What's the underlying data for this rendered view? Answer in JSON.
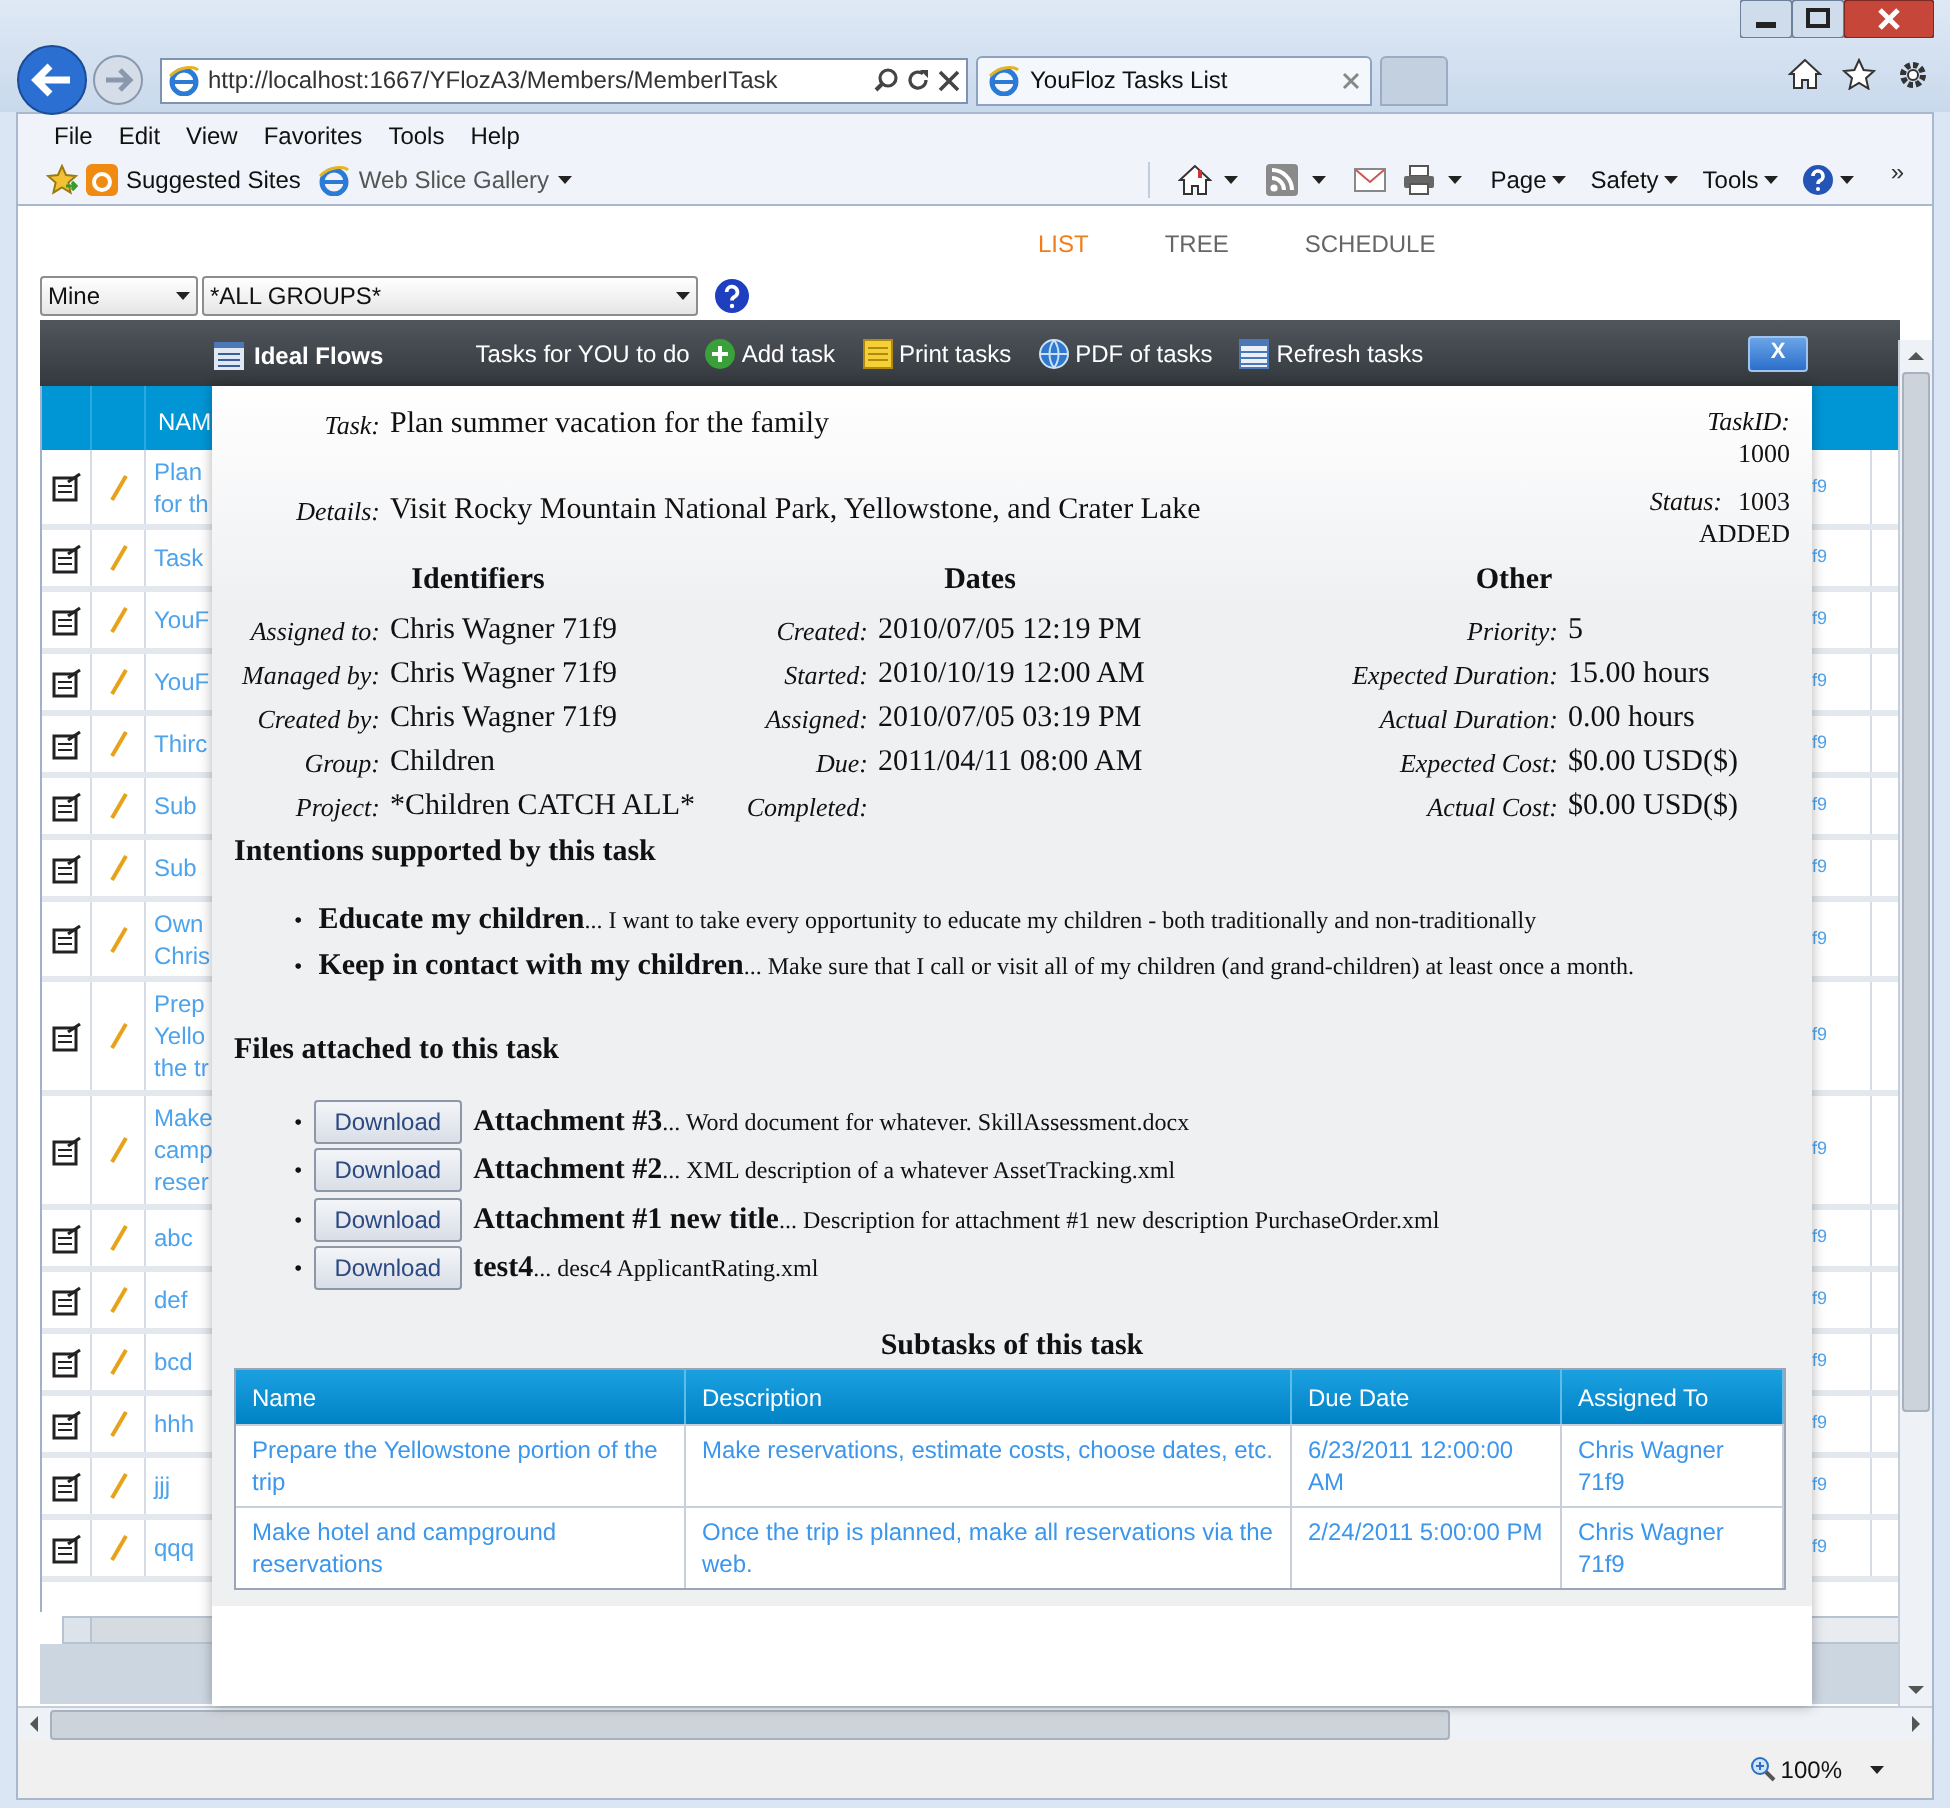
{
  "browser": {
    "url": "http://localhost:1667/YFlozA3/Members/MemberITask",
    "tab_title": "YouFloz Tasks List",
    "menu": [
      "File",
      "Edit",
      "View",
      "Favorites",
      "Tools",
      "Help"
    ],
    "favorites": [
      {
        "kind": "suggested",
        "label": "Suggested Sites"
      },
      {
        "kind": "slice",
        "label": "Web Slice Gallery"
      }
    ],
    "commands": [
      "Page",
      "Safety",
      "Tools"
    ],
    "overflow": "»",
    "zoom": "100%"
  },
  "nav": [
    {
      "label": "LIST",
      "selected": true
    },
    {
      "label": "TREE",
      "selected": false
    },
    {
      "label": "SCHEDULE",
      "selected": false
    }
  ],
  "filters": {
    "owner": "Mine",
    "group": "*ALL GROUPS*"
  },
  "toolbar": {
    "brand": "Ideal Flows",
    "caption": "Tasks for YOU to do",
    "actions": [
      {
        "kind": "add",
        "label": "Add task"
      },
      {
        "kind": "print",
        "label": "Print tasks"
      },
      {
        "kind": "pdf",
        "label": "PDF of tasks"
      },
      {
        "kind": "refresh",
        "label": "Refresh tasks"
      }
    ],
    "close": "X"
  },
  "list": {
    "header": "NAM",
    "rows": [
      {
        "lines": [
          "Plan",
          "for th"
        ],
        "end": "f9"
      },
      {
        "lines": [
          "Task"
        ],
        "end": "f9"
      },
      {
        "lines": [
          "YouF"
        ],
        "end": "f9"
      },
      {
        "lines": [
          "YouF"
        ],
        "end": "f9"
      },
      {
        "lines": [
          "Thirc"
        ],
        "end": "f9"
      },
      {
        "lines": [
          "Sub"
        ],
        "end": "f9"
      },
      {
        "lines": [
          "Sub"
        ],
        "end": "f9"
      },
      {
        "lines": [
          "Own",
          "Chris"
        ],
        "end": "f9"
      },
      {
        "lines": [
          "Prep",
          "Yello",
          "the tr"
        ],
        "end": "f9"
      },
      {
        "lines": [
          "Make",
          "camp",
          "reser"
        ],
        "end": "f9"
      },
      {
        "lines": [
          "abc"
        ],
        "end": "f9"
      },
      {
        "lines": [
          "def"
        ],
        "end": "f9"
      },
      {
        "lines": [
          "bcd"
        ],
        "end": "f9"
      },
      {
        "lines": [
          "hhh"
        ],
        "end": "f9"
      },
      {
        "lines": [
          "jjj"
        ],
        "end": "f9"
      },
      {
        "lines": [
          "qqq"
        ],
        "end": "f9"
      }
    ]
  },
  "detail": {
    "task_label": "Task:",
    "task": "Plan summer vacation for the family",
    "details_label": "Details:",
    "details": "Visit Rocky Mountain National Park, Yellowstone, and Crater Lake",
    "taskid_label": "TaskID:",
    "taskid": "1000",
    "status_label": "Status:",
    "status_code": "1003",
    "status": "ADDED",
    "groups": [
      {
        "title": "Identifiers",
        "fields": [
          {
            "label": "Assigned to:",
            "value": "Chris Wagner 71f9"
          },
          {
            "label": "Managed by:",
            "value": "Chris Wagner 71f9"
          },
          {
            "label": "Created by:",
            "value": "Chris Wagner 71f9"
          },
          {
            "label": "Group:",
            "value": "Children"
          },
          {
            "label": "Project:",
            "value": "*Children CATCH ALL*"
          }
        ]
      },
      {
        "title": "Dates",
        "fields": [
          {
            "label": "Created:",
            "value": "2010/07/05 12:19 PM"
          },
          {
            "label": "Started:",
            "value": "2010/10/19 12:00 AM"
          },
          {
            "label": "Assigned:",
            "value": "2010/07/05 03:19 PM"
          },
          {
            "label": "Due:",
            "value": "2011/04/11 08:00 AM"
          },
          {
            "label": "Completed:"
          }
        ]
      },
      {
        "title": "Other",
        "fields": [
          {
            "label": "Priority:",
            "value": "5"
          },
          {
            "label": "Expected Duration:",
            "value": "15.00 hours"
          },
          {
            "label": "Actual Duration:",
            "value": "0.00 hours"
          },
          {
            "label": "Expected Cost:",
            "value": "$0.00 USD($)"
          },
          {
            "label": "Actual Cost:",
            "value": "$0.00 USD($)"
          }
        ]
      }
    ],
    "intentions_title": "Intentions supported by this task",
    "intentions": [
      {
        "bullet": "•",
        "title": "Educate my children",
        "description": "... I want to take every opportunity to educate my children - both traditionally and non-traditionally"
      },
      {
        "bullet": "•",
        "title": "Keep in contact with my children",
        "description": "... Make sure that I call or visit all of my children (and grand-children) at least once a month."
      }
    ],
    "files_title": "Files attached to this task",
    "files": [
      {
        "bullet": "•",
        "button": "Download",
        "title": "Attachment #3",
        "description": "... Word document for whatever. SkillAssessment.docx"
      },
      {
        "bullet": "•",
        "button": "Download",
        "title": "Attachment #2",
        "description": "... XML description of a whatever AssetTracking.xml"
      },
      {
        "bullet": "•",
        "button": "Download",
        "title": "Attachment #1 new title",
        "description": "... Description for attachment #1 new description PurchaseOrder.xml"
      },
      {
        "bullet": "•",
        "button": "Download",
        "title": "test4",
        "description": "... desc4 ApplicantRating.xml"
      }
    ],
    "subtasks_title": "Subtasks of this task",
    "subtasks": {
      "columns": [
        "Name",
        "Description",
        "Due Date",
        "Assigned To"
      ],
      "rows": [
        [
          "Prepare the Yellowstone portion of the trip",
          "Make reservations, estimate costs, choose dates, etc.",
          "6/23/2011 12:00:00 AM",
          "Chris Wagner 71f9"
        ],
        [
          "Make hotel and campground reservations",
          "Once the trip is planned, make all reservations via the web.",
          "2/24/2011 5:00:00 PM",
          "Chris Wagner 71f9"
        ]
      ]
    }
  }
}
